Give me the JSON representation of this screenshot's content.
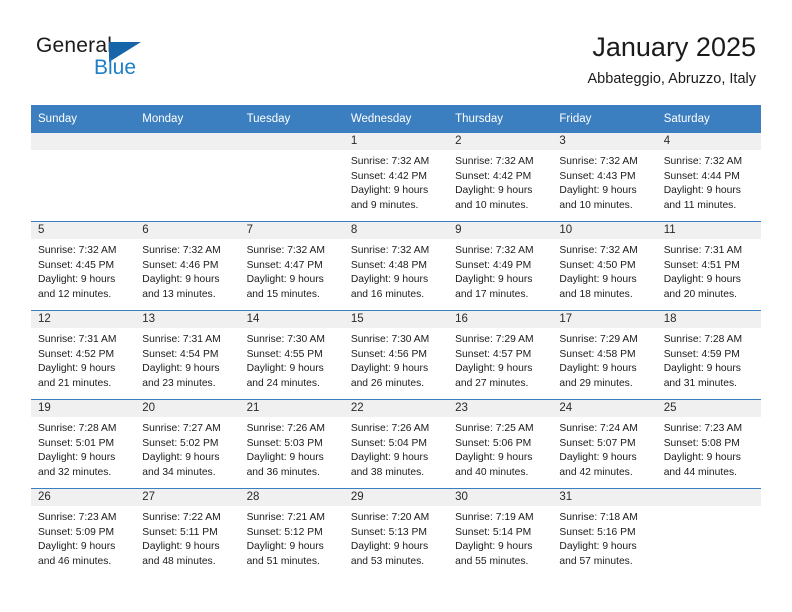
{
  "brand": {
    "word_one": "General",
    "word_two": "Blue",
    "accent_color": "#1f7fc4",
    "triangle_color": "#1565a8",
    "logo_icon": "general-blue-triangle-logo"
  },
  "header": {
    "title": "January 2025",
    "subtitle": "Abbateggio, Abruzzo, Italy"
  },
  "theme": {
    "header_blue": "#3c7fc0",
    "daynum_band": "#f0f0f0",
    "text": "#1b1b1b"
  },
  "weekdays": [
    "Sunday",
    "Monday",
    "Tuesday",
    "Wednesday",
    "Thursday",
    "Friday",
    "Saturday"
  ],
  "labels": {
    "sunrise": "Sunrise:",
    "sunset": "Sunset:",
    "daylight": "Daylight:"
  },
  "weeks": [
    [
      {
        "day": "",
        "empty": true
      },
      {
        "day": "",
        "empty": true
      },
      {
        "day": "",
        "empty": true
      },
      {
        "day": "1",
        "sunrise": "Sunrise: 7:32 AM",
        "sunset": "Sunset: 4:42 PM",
        "daylight_line1": "Daylight: 9 hours",
        "daylight_line2": "and 9 minutes."
      },
      {
        "day": "2",
        "sunrise": "Sunrise: 7:32 AM",
        "sunset": "Sunset: 4:42 PM",
        "daylight_line1": "Daylight: 9 hours",
        "daylight_line2": "and 10 minutes."
      },
      {
        "day": "3",
        "sunrise": "Sunrise: 7:32 AM",
        "sunset": "Sunset: 4:43 PM",
        "daylight_line1": "Daylight: 9 hours",
        "daylight_line2": "and 10 minutes."
      },
      {
        "day": "4",
        "sunrise": "Sunrise: 7:32 AM",
        "sunset": "Sunset: 4:44 PM",
        "daylight_line1": "Daylight: 9 hours",
        "daylight_line2": "and 11 minutes."
      }
    ],
    [
      {
        "day": "5",
        "sunrise": "Sunrise: 7:32 AM",
        "sunset": "Sunset: 4:45 PM",
        "daylight_line1": "Daylight: 9 hours",
        "daylight_line2": "and 12 minutes."
      },
      {
        "day": "6",
        "sunrise": "Sunrise: 7:32 AM",
        "sunset": "Sunset: 4:46 PM",
        "daylight_line1": "Daylight: 9 hours",
        "daylight_line2": "and 13 minutes."
      },
      {
        "day": "7",
        "sunrise": "Sunrise: 7:32 AM",
        "sunset": "Sunset: 4:47 PM",
        "daylight_line1": "Daylight: 9 hours",
        "daylight_line2": "and 15 minutes."
      },
      {
        "day": "8",
        "sunrise": "Sunrise: 7:32 AM",
        "sunset": "Sunset: 4:48 PM",
        "daylight_line1": "Daylight: 9 hours",
        "daylight_line2": "and 16 minutes."
      },
      {
        "day": "9",
        "sunrise": "Sunrise: 7:32 AM",
        "sunset": "Sunset: 4:49 PM",
        "daylight_line1": "Daylight: 9 hours",
        "daylight_line2": "and 17 minutes."
      },
      {
        "day": "10",
        "sunrise": "Sunrise: 7:32 AM",
        "sunset": "Sunset: 4:50 PM",
        "daylight_line1": "Daylight: 9 hours",
        "daylight_line2": "and 18 minutes."
      },
      {
        "day": "11",
        "sunrise": "Sunrise: 7:31 AM",
        "sunset": "Sunset: 4:51 PM",
        "daylight_line1": "Daylight: 9 hours",
        "daylight_line2": "and 20 minutes."
      }
    ],
    [
      {
        "day": "12",
        "sunrise": "Sunrise: 7:31 AM",
        "sunset": "Sunset: 4:52 PM",
        "daylight_line1": "Daylight: 9 hours",
        "daylight_line2": "and 21 minutes."
      },
      {
        "day": "13",
        "sunrise": "Sunrise: 7:31 AM",
        "sunset": "Sunset: 4:54 PM",
        "daylight_line1": "Daylight: 9 hours",
        "daylight_line2": "and 23 minutes."
      },
      {
        "day": "14",
        "sunrise": "Sunrise: 7:30 AM",
        "sunset": "Sunset: 4:55 PM",
        "daylight_line1": "Daylight: 9 hours",
        "daylight_line2": "and 24 minutes."
      },
      {
        "day": "15",
        "sunrise": "Sunrise: 7:30 AM",
        "sunset": "Sunset: 4:56 PM",
        "daylight_line1": "Daylight: 9 hours",
        "daylight_line2": "and 26 minutes."
      },
      {
        "day": "16",
        "sunrise": "Sunrise: 7:29 AM",
        "sunset": "Sunset: 4:57 PM",
        "daylight_line1": "Daylight: 9 hours",
        "daylight_line2": "and 27 minutes."
      },
      {
        "day": "17",
        "sunrise": "Sunrise: 7:29 AM",
        "sunset": "Sunset: 4:58 PM",
        "daylight_line1": "Daylight: 9 hours",
        "daylight_line2": "and 29 minutes."
      },
      {
        "day": "18",
        "sunrise": "Sunrise: 7:28 AM",
        "sunset": "Sunset: 4:59 PM",
        "daylight_line1": "Daylight: 9 hours",
        "daylight_line2": "and 31 minutes."
      }
    ],
    [
      {
        "day": "19",
        "sunrise": "Sunrise: 7:28 AM",
        "sunset": "Sunset: 5:01 PM",
        "daylight_line1": "Daylight: 9 hours",
        "daylight_line2": "and 32 minutes."
      },
      {
        "day": "20",
        "sunrise": "Sunrise: 7:27 AM",
        "sunset": "Sunset: 5:02 PM",
        "daylight_line1": "Daylight: 9 hours",
        "daylight_line2": "and 34 minutes."
      },
      {
        "day": "21",
        "sunrise": "Sunrise: 7:26 AM",
        "sunset": "Sunset: 5:03 PM",
        "daylight_line1": "Daylight: 9 hours",
        "daylight_line2": "and 36 minutes."
      },
      {
        "day": "22",
        "sunrise": "Sunrise: 7:26 AM",
        "sunset": "Sunset: 5:04 PM",
        "daylight_line1": "Daylight: 9 hours",
        "daylight_line2": "and 38 minutes."
      },
      {
        "day": "23",
        "sunrise": "Sunrise: 7:25 AM",
        "sunset": "Sunset: 5:06 PM",
        "daylight_line1": "Daylight: 9 hours",
        "daylight_line2": "and 40 minutes."
      },
      {
        "day": "24",
        "sunrise": "Sunrise: 7:24 AM",
        "sunset": "Sunset: 5:07 PM",
        "daylight_line1": "Daylight: 9 hours",
        "daylight_line2": "and 42 minutes."
      },
      {
        "day": "25",
        "sunrise": "Sunrise: 7:23 AM",
        "sunset": "Sunset: 5:08 PM",
        "daylight_line1": "Daylight: 9 hours",
        "daylight_line2": "and 44 minutes."
      }
    ],
    [
      {
        "day": "26",
        "sunrise": "Sunrise: 7:23 AM",
        "sunset": "Sunset: 5:09 PM",
        "daylight_line1": "Daylight: 9 hours",
        "daylight_line2": "and 46 minutes."
      },
      {
        "day": "27",
        "sunrise": "Sunrise: 7:22 AM",
        "sunset": "Sunset: 5:11 PM",
        "daylight_line1": "Daylight: 9 hours",
        "daylight_line2": "and 48 minutes."
      },
      {
        "day": "28",
        "sunrise": "Sunrise: 7:21 AM",
        "sunset": "Sunset: 5:12 PM",
        "daylight_line1": "Daylight: 9 hours",
        "daylight_line2": "and 51 minutes."
      },
      {
        "day": "29",
        "sunrise": "Sunrise: 7:20 AM",
        "sunset": "Sunset: 5:13 PM",
        "daylight_line1": "Daylight: 9 hours",
        "daylight_line2": "and 53 minutes."
      },
      {
        "day": "30",
        "sunrise": "Sunrise: 7:19 AM",
        "sunset": "Sunset: 5:14 PM",
        "daylight_line1": "Daylight: 9 hours",
        "daylight_line2": "and 55 minutes."
      },
      {
        "day": "31",
        "sunrise": "Sunrise: 7:18 AM",
        "sunset": "Sunset: 5:16 PM",
        "daylight_line1": "Daylight: 9 hours",
        "daylight_line2": "and 57 minutes."
      },
      {
        "day": "",
        "empty": true
      }
    ]
  ]
}
